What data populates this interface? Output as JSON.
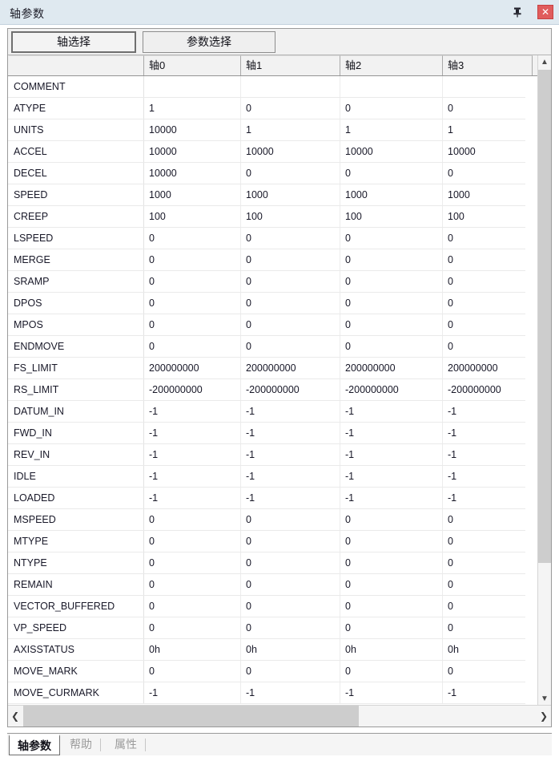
{
  "window": {
    "title": "轴参数",
    "pin_icon": "pin-icon",
    "close_label": "✕"
  },
  "toolbar": {
    "axis_select_label": "轴选择",
    "param_select_label": "参数选择"
  },
  "grid": {
    "columns": [
      "",
      "轴0",
      "轴1",
      "轴2",
      "轴3"
    ],
    "rows": [
      {
        "name": "COMMENT",
        "values": [
          "",
          "",
          "",
          ""
        ]
      },
      {
        "name": "ATYPE",
        "values": [
          "1",
          "0",
          "0",
          "0"
        ]
      },
      {
        "name": "UNITS",
        "values": [
          "10000",
          "1",
          "1",
          "1"
        ]
      },
      {
        "name": "ACCEL",
        "values": [
          "10000",
          "10000",
          "10000",
          "10000"
        ]
      },
      {
        "name": "DECEL",
        "values": [
          "10000",
          "0",
          "0",
          "0"
        ]
      },
      {
        "name": "SPEED",
        "values": [
          "1000",
          "1000",
          "1000",
          "1000"
        ]
      },
      {
        "name": "CREEP",
        "values": [
          "100",
          "100",
          "100",
          "100"
        ]
      },
      {
        "name": "LSPEED",
        "values": [
          "0",
          "0",
          "0",
          "0"
        ]
      },
      {
        "name": "MERGE",
        "values": [
          "0",
          "0",
          "0",
          "0"
        ]
      },
      {
        "name": "SRAMP",
        "values": [
          "0",
          "0",
          "0",
          "0"
        ]
      },
      {
        "name": "DPOS",
        "values": [
          "0",
          "0",
          "0",
          "0"
        ]
      },
      {
        "name": "MPOS",
        "values": [
          "0",
          "0",
          "0",
          "0"
        ]
      },
      {
        "name": "ENDMOVE",
        "values": [
          "0",
          "0",
          "0",
          "0"
        ]
      },
      {
        "name": "FS_LIMIT",
        "values": [
          "200000000",
          "200000000",
          "200000000",
          "200000000"
        ]
      },
      {
        "name": "RS_LIMIT",
        "values": [
          "-200000000",
          "-200000000",
          "-200000000",
          "-200000000"
        ]
      },
      {
        "name": "DATUM_IN",
        "values": [
          "-1",
          "-1",
          "-1",
          "-1"
        ]
      },
      {
        "name": "FWD_IN",
        "values": [
          "-1",
          "-1",
          "-1",
          "-1"
        ]
      },
      {
        "name": "REV_IN",
        "values": [
          "-1",
          "-1",
          "-1",
          "-1"
        ]
      },
      {
        "name": "IDLE",
        "values": [
          "-1",
          "-1",
          "-1",
          "-1"
        ]
      },
      {
        "name": "LOADED",
        "values": [
          "-1",
          "-1",
          "-1",
          "-1"
        ]
      },
      {
        "name": "MSPEED",
        "values": [
          "0",
          "0",
          "0",
          "0"
        ]
      },
      {
        "name": "MTYPE",
        "values": [
          "0",
          "0",
          "0",
          "0"
        ]
      },
      {
        "name": "NTYPE",
        "values": [
          "0",
          "0",
          "0",
          "0"
        ]
      },
      {
        "name": "REMAIN",
        "values": [
          "0",
          "0",
          "0",
          "0"
        ]
      },
      {
        "name": "VECTOR_BUFFERED",
        "values": [
          "0",
          "0",
          "0",
          "0"
        ]
      },
      {
        "name": "VP_SPEED",
        "values": [
          "0",
          "0",
          "0",
          "0"
        ]
      },
      {
        "name": "AXISSTATUS",
        "values": [
          "0h",
          "0h",
          "0h",
          "0h"
        ]
      },
      {
        "name": "MOVE_MARK",
        "values": [
          "0",
          "0",
          "0",
          "0"
        ]
      },
      {
        "name": "MOVE_CURMARK",
        "values": [
          "-1",
          "-1",
          "-1",
          "-1"
        ]
      }
    ]
  },
  "scrollbars": {
    "v_up": "▲",
    "v_down": "▼",
    "h_left": "❮",
    "h_right": "❯"
  },
  "tabs": [
    {
      "label": "轴参数",
      "active": true
    },
    {
      "label": "帮助",
      "active": false
    },
    {
      "label": "属性",
      "active": false
    }
  ],
  "colors": {
    "titlebar": "#dfe9f0",
    "close_button": "#e05c5c",
    "scroll_thumb": "#cdcdcd"
  }
}
